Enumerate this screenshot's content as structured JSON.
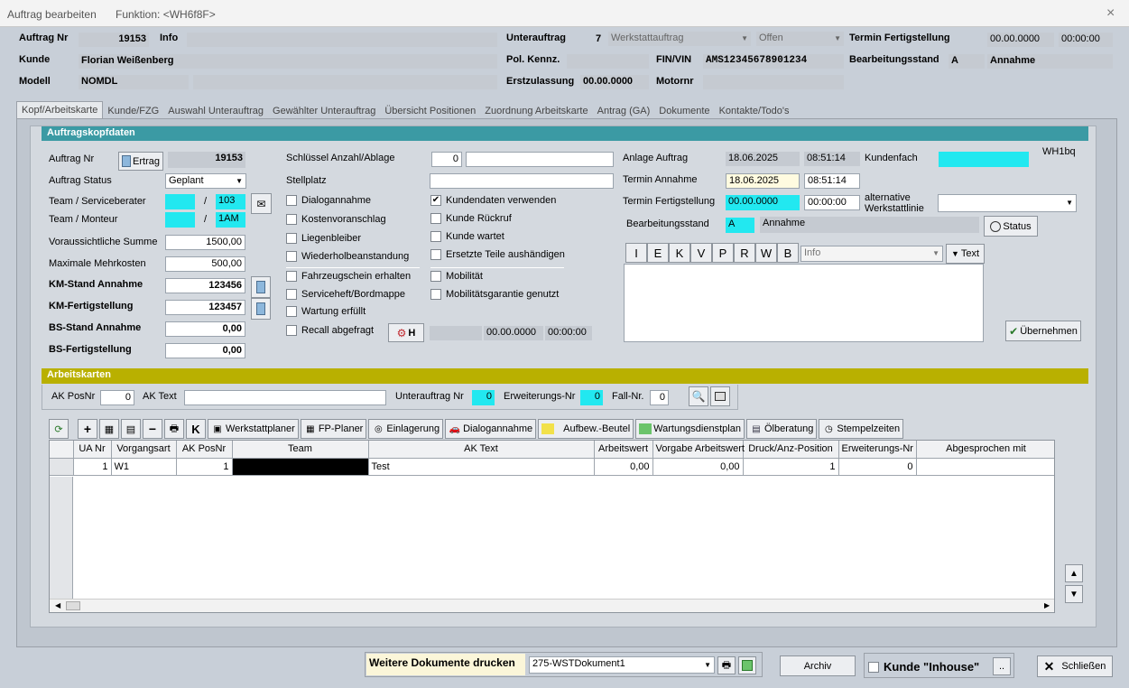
{
  "window": {
    "title": "Auftrag bearbeiten",
    "function": "Funktion: <WH6f8F>",
    "close": "×"
  },
  "header": {
    "auftrag_nr_label": "Auftrag Nr",
    "auftrag_nr": "19153",
    "info_label": "Info",
    "info_value": "",
    "unterauftrag_label": "Unterauftrag",
    "unterauftrag_nr": "7",
    "unterauftrag_type": "Werkstattauftrag",
    "unterauftrag_status": "Offen",
    "termin_label": "Termin Fertigstellung",
    "termin_date": "00.00.0000",
    "termin_time": "00:00:00",
    "kunde_label": "Kunde",
    "kunde": "Florian Weißenberg",
    "pol_label": "Pol. Kennz.",
    "pol_value": "",
    "fin_label": "FIN/VIN",
    "fin": "AMS12345678901234",
    "bearb_label": "Bearbeitungsstand",
    "bearb_code": "A",
    "bearb_text": "Annahme",
    "modell_label": "Modell",
    "modell": "NOMDL",
    "erstzul_label": "Erstzulassung",
    "erstzul": "00.00.0000",
    "motornr_label": "Motornr",
    "motornr": ""
  },
  "tabs": [
    "Kopf/Arbeitskarte",
    "Kunde/FZG",
    "Auswahl Unterauftrag",
    "Gewählter Unterauftrag",
    "Übersicht Positionen",
    "Zuordnung Arbeitskarte",
    "Antrag (GA)",
    "Dokumente",
    "Kontakte/Todo's"
  ],
  "kopf": {
    "section": "Auftragskopfdaten",
    "auftrag_nr_label": "Auftrag Nr",
    "ertrag_button": "Ertrag",
    "auftrag_nr": "19153",
    "status_label": "Auftrag Status",
    "status_value": "Geplant",
    "team_sb_label": "Team / Serviceberater",
    "team_sb_value": "103",
    "team_mon_label": "Team / Monteur",
    "team_mon_value": "1AM",
    "slash": "/",
    "summe_label": "Voraussichtliche Summe",
    "summe": "1500,00",
    "mehrkosten_label": "Maximale Mehrkosten",
    "mehrkosten": "500,00",
    "km_annahme_label": "KM-Stand Annahme",
    "km_annahme": "123456",
    "km_fertig_label": "KM-Fertigstellung",
    "km_fertig": "123457",
    "bs_annahme_label": "BS-Stand Annahme",
    "bs_annahme": "0,00",
    "bs_fertig_label": "BS-Fertigstellung",
    "bs_fertig": "0,00",
    "schluessel_label": "Schlüssel Anzahl/Ablage",
    "schluessel_anzahl": "0",
    "schluessel_ablage": "",
    "stellplatz_label": "Stellplatz",
    "stellplatz": "",
    "checks_left": [
      {
        "label": "Dialogannahme",
        "checked": false
      },
      {
        "label": "Kostenvoranschlag",
        "checked": false
      },
      {
        "label": "Liegenbleiber",
        "checked": false
      },
      {
        "label": "Wiederholbeanstandung",
        "checked": false
      },
      {
        "label": "Fahrzeugschein  erhalten",
        "checked": false
      },
      {
        "label": "Serviceheft/Bordmappe",
        "checked": false
      },
      {
        "label": "Wartung erfüllt",
        "checked": false
      },
      {
        "label": "Recall abgefragt",
        "checked": false
      }
    ],
    "checks_right": [
      {
        "label": "Kundendaten verwenden",
        "checked": true
      },
      {
        "label": "Kunde Rückruf",
        "checked": false
      },
      {
        "label": "Kunde wartet",
        "checked": false
      },
      {
        "label": "Ersetzte Teile aushändigen",
        "checked": false
      },
      {
        "label": "Mobilität",
        "checked": false
      },
      {
        "label": "Mobilitätsgarantie genutzt",
        "checked": false
      }
    ],
    "recall_h": "H",
    "recall_date": "00.00.0000",
    "recall_time": "00:00:00",
    "anlage_label": "Anlage Auftrag",
    "anlage_date": "18.06.2025",
    "anlage_time": "08:51:14",
    "kundenfach_label": "Kundenfach",
    "kundenfach": "",
    "wh_code": "WH1bq",
    "termin_annahme_label": "Termin Annahme",
    "termin_annahme_date": "18.06.2025",
    "termin_annahme_time": "08:51:14",
    "termin_fertig_label": "Termin Fertigstellung",
    "termin_fertig_date": "00.00.0000",
    "termin_fertig_time": "00:00:00",
    "alt_label": "alternative Werkstattlinie",
    "alt_value": "",
    "bearb_label": "Bearbeitungsstand",
    "bearb_code": "A",
    "bearb_text": "Annahme",
    "status_button": "Status",
    "text_buttons": [
      "I",
      "E",
      "K",
      "V",
      "P",
      "R",
      "W",
      "B"
    ],
    "text_select": "Info",
    "text_button": "Text",
    "uebernehmen": "Übernehmen"
  },
  "ak": {
    "section": "Arbeitskarten",
    "posnr_label": "AK PosNr",
    "posnr": "0",
    "text_label": "AK Text",
    "text": "",
    "ua_label": "Unterauftrag Nr",
    "ua": "0",
    "erw_label": "Erweiterungs-Nr",
    "erw": "0",
    "fall_label": "Fall-Nr.",
    "fall": "0",
    "toolbar": [
      "Werkstattplaner",
      "FP-Planer",
      "Einlagerung",
      "Dialogannahme",
      "Aufbew.-Beutel",
      "Wartungsdienstplan",
      "Ölberatung",
      "Stempelzeiten"
    ],
    "tool_k": "K",
    "columns": [
      "UA Nr",
      "Vorgangsart",
      "AK PosNr",
      "Team",
      "AK Text",
      "Arbeitswert",
      "Vorgabe Arbeitswert",
      "Druck/Anz-Position",
      "Erweiterungs-Nr",
      "Abgesprochen mit"
    ],
    "rows": [
      [
        "1",
        "W1",
        "1",
        "",
        "Test",
        "0,00",
        "0,00",
        "1",
        "0",
        ""
      ]
    ]
  },
  "footer": {
    "weitere_label": "Weitere Dokumente drucken",
    "dokument": "275-WSTDokument1",
    "archiv": "Archiv",
    "inhouse": "Kunde \"Inhouse\"",
    "dots": "..",
    "schliessen": "Schließen"
  },
  "colors": {
    "teal": "#3b9aa4",
    "olive": "#b9b000",
    "cyan": "#22e8f0"
  }
}
